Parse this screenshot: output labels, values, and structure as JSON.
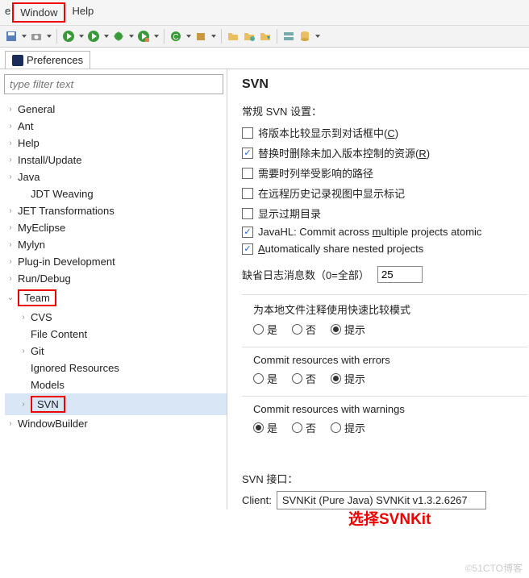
{
  "menubar": {
    "window": "Window",
    "help": "Help"
  },
  "tab": {
    "title": "Preferences"
  },
  "filter": {
    "placeholder": "type filter text"
  },
  "tree": {
    "items": [
      {
        "label": "General",
        "level": 0,
        "exp": ">"
      },
      {
        "label": "Ant",
        "level": 0,
        "exp": ">"
      },
      {
        "label": "Help",
        "level": 0,
        "exp": ">"
      },
      {
        "label": "Install/Update",
        "level": 0,
        "exp": ">"
      },
      {
        "label": "Java",
        "level": 0,
        "exp": ">"
      },
      {
        "label": "JDT Weaving",
        "level": 1,
        "exp": ""
      },
      {
        "label": "JET Transformations",
        "level": 0,
        "exp": ">"
      },
      {
        "label": "MyEclipse",
        "level": 0,
        "exp": ">"
      },
      {
        "label": "Mylyn",
        "level": 0,
        "exp": ">"
      },
      {
        "label": "Plug-in Development",
        "level": 0,
        "exp": ">"
      },
      {
        "label": "Run/Debug",
        "level": 0,
        "exp": ">"
      },
      {
        "label": "Team",
        "level": 0,
        "exp": "v",
        "box": true
      },
      {
        "label": "CVS",
        "level": 1,
        "exp": ">"
      },
      {
        "label": "File Content",
        "level": 1,
        "exp": ""
      },
      {
        "label": "Git",
        "level": 1,
        "exp": ">"
      },
      {
        "label": "Ignored Resources",
        "level": 1,
        "exp": ""
      },
      {
        "label": "Models",
        "level": 1,
        "exp": ""
      },
      {
        "label": "SVN",
        "level": 1,
        "exp": ">",
        "box": true,
        "sel": true
      },
      {
        "label": "WindowBuilder",
        "level": 0,
        "exp": ">"
      }
    ]
  },
  "page": {
    "title": "SVN",
    "general_heading": "常规 SVN 设置：",
    "checks": [
      {
        "label_pre": "将版本比较显示到对话框中(",
        "u": "C",
        "label_post": ")",
        "checked": false
      },
      {
        "label_pre": "替换时删除未加入版本控制的资源(",
        "u": "R",
        "label_post": ")",
        "checked": true
      },
      {
        "label_pre": "需要时列举受影响的路径",
        "u": "",
        "label_post": "",
        "checked": false
      },
      {
        "label_pre": "在远程历史记录视图中显示标记",
        "u": "",
        "label_post": "",
        "checked": false
      },
      {
        "label_pre": "显示过期目录",
        "u": "",
        "label_post": "",
        "checked": false
      },
      {
        "label_pre": "JavaHL: Commit across ",
        "u": "m",
        "label_post": "ultiple projects atomic",
        "checked": true
      },
      {
        "label_pre": "",
        "u": "A",
        "label_post": "utomatically share nested projects",
        "checked": true
      }
    ],
    "log_label": "缺省日志消息数（0=全部）",
    "log_value": "25",
    "groups": [
      {
        "title": "为本地文件注释使用快速比较模式",
        "opts": [
          "是",
          "否",
          "提示"
        ],
        "sel": 2
      },
      {
        "title": "Commit resources with errors",
        "opts": [
          "是",
          "否",
          "提示"
        ],
        "sel": 2
      },
      {
        "title": "Commit resources with warnings",
        "opts": [
          "是",
          "否",
          "提示"
        ],
        "sel": 0
      }
    ],
    "annotation": "选择SVNKit",
    "iface_label": "SVN 接口：",
    "client_label": "Client:",
    "client_value": "SVNKit (Pure Java) SVNKit v1.3.2.6267"
  },
  "watermark": "©51CTO博客"
}
